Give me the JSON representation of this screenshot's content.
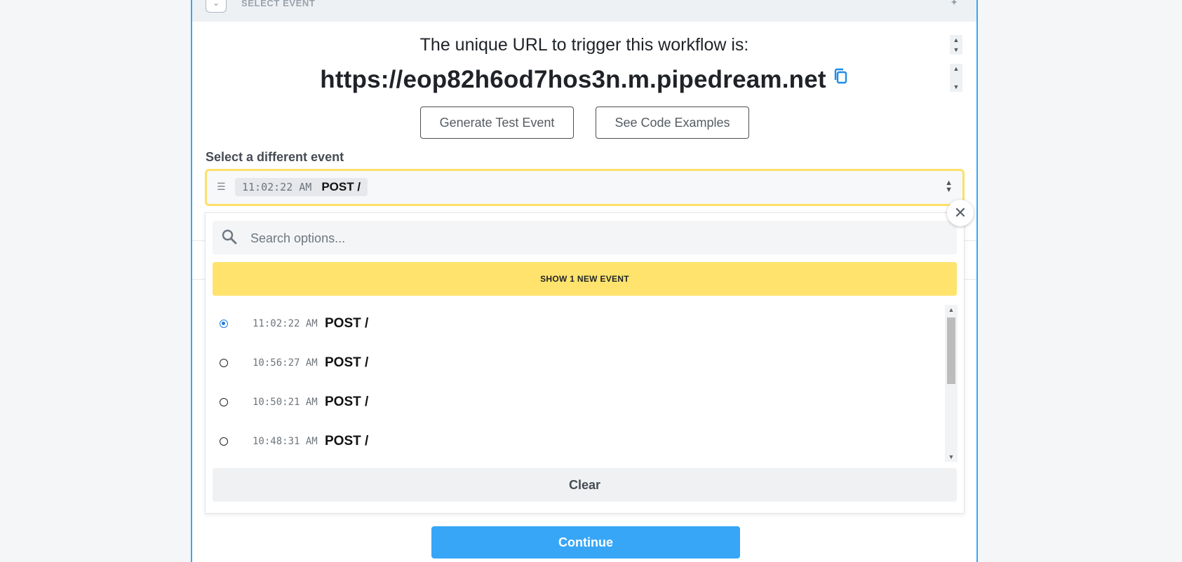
{
  "header": {
    "title": "SELECT EVENT",
    "toggle_icon": "chevron-down-icon",
    "pin_icon": "pin-off-icon"
  },
  "trigger": {
    "caption": "The unique URL to trigger this workflow is:",
    "url": "https://eop82h6od7hos3n.m.pipedream.net",
    "copy_icon": "copy-icon"
  },
  "buttons": {
    "generate": "Generate Test Event",
    "examples": "See Code Examples",
    "continue": "Continue"
  },
  "event_select": {
    "label": "Select a different event",
    "selected_time": "11:02:22 AM",
    "selected_method": "POST /"
  },
  "dropdown": {
    "search_placeholder": "Search options...",
    "show_new": "SHOW 1 NEW EVENT",
    "clear": "Clear",
    "options": [
      {
        "time": "11:02:22 AM",
        "method": "POST /",
        "checked": true
      },
      {
        "time": "10:56:27 AM",
        "method": "POST /",
        "checked": false
      },
      {
        "time": "10:50:21 AM",
        "method": "POST /",
        "checked": false
      },
      {
        "time": "10:48:31 AM",
        "method": "POST /",
        "checked": false
      }
    ]
  },
  "colors": {
    "accent": "#37a6f7",
    "highlight": "#ffe36c",
    "radio_selected": "#1f7ee0"
  }
}
